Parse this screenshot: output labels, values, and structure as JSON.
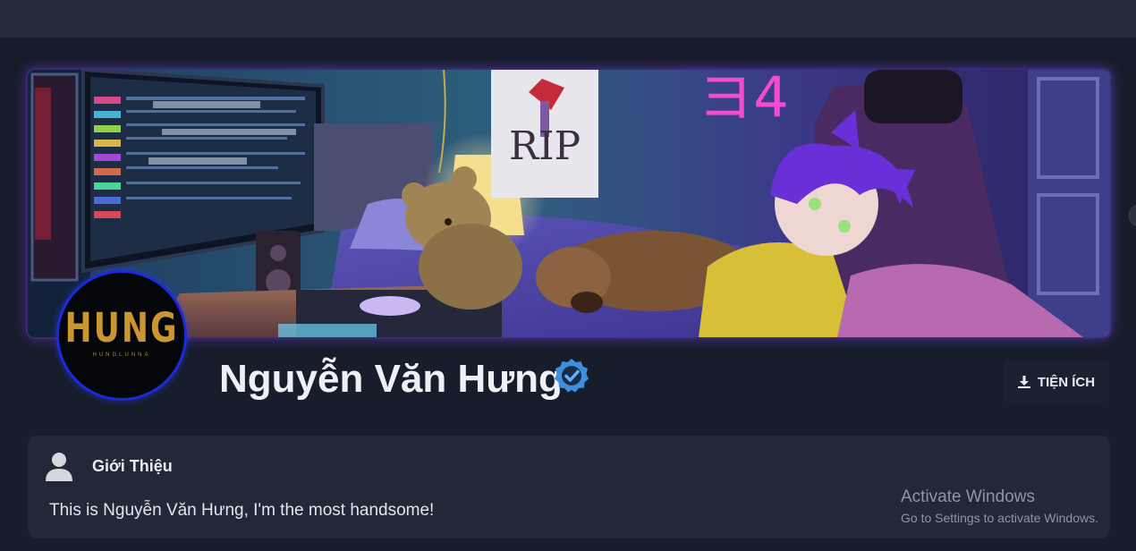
{
  "profile": {
    "name": "Nguyễn Văn Hưng",
    "verified": true,
    "avatar_logo": "HUNG",
    "avatar_sub": "HUNGLUNNA",
    "tools_button": "TIỆN ÍCH",
    "banner_sign": "RIP",
    "banner_neon": "ヨ4"
  },
  "about": {
    "title": "Giới Thiệu",
    "text": "This is Nguyễn Văn Hưng, I'm the most handsome!"
  },
  "watermark": {
    "line1": "Activate Windows",
    "line2": "Go to Settings to activate Windows."
  },
  "icons": {
    "verify": "check-badge-icon",
    "download": "download-icon",
    "user": "user-icon"
  },
  "colors": {
    "page_bg": "#171d2b",
    "card_bg": "#222837",
    "verify_blue": "#3f8fe0",
    "avatar_border": "#1c2ad8",
    "neon_pink": "#ff4bd8"
  }
}
